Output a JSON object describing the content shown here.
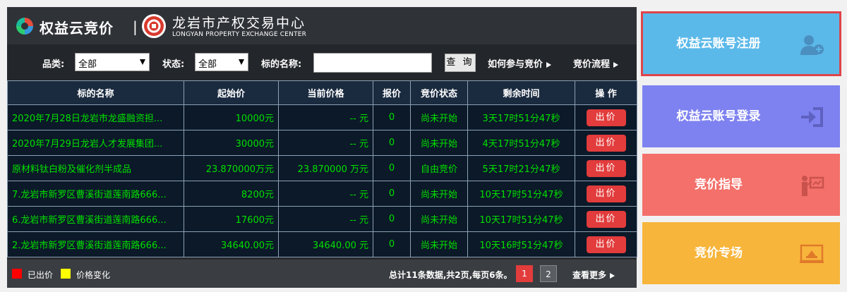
{
  "header": {
    "brand_name": "权益云竞价",
    "separator": "|",
    "org_name": "龙岩市产权交易中心",
    "org_name_en": "LONGYAN PROPERTY EXCHANGE CENTER"
  },
  "filters": {
    "category_label": "品类:",
    "category_value": "全部",
    "status_label": "状态:",
    "status_value": "全部",
    "name_label": "标的名称:",
    "name_value": "",
    "query_button": "查 询",
    "how_to_link": "如何参与竞价",
    "process_link": "竞价流程"
  },
  "table": {
    "columns": [
      "标的名称",
      "起始价",
      "当前价格",
      "报价",
      "竞价状态",
      "剩余时间",
      "操 作"
    ],
    "rows": [
      {
        "name": "2020年7月28日龙岩市龙盛融资担...",
        "start_price": "10000元",
        "current_price": "-- 元",
        "bids": "0",
        "status": "尚未开始",
        "remaining": "3天17时51分47秒",
        "action": "出价"
      },
      {
        "name": "2020年7月29日龙岩人才发展集团...",
        "start_price": "30000元",
        "current_price": "-- 元",
        "bids": "0",
        "status": "尚未开始",
        "remaining": "4天17时51分47秒",
        "action": "出价"
      },
      {
        "name": "原材料钛白粉及催化剂半成品",
        "start_price": "23.870000万元",
        "current_price": "23.870000 万元",
        "bids": "0",
        "status": "自由竞价",
        "remaining": "5天17时21分47秒",
        "action": "出价"
      },
      {
        "name": "7.龙岩市新罗区曹溪街道莲南路666...",
        "start_price": "8200元",
        "current_price": "-- 元",
        "bids": "0",
        "status": "尚未开始",
        "remaining": "10天17时51分47秒",
        "action": "出价"
      },
      {
        "name": "6.龙岩市新罗区曹溪街道莲南路666...",
        "start_price": "17600元",
        "current_price": "-- 元",
        "bids": "0",
        "status": "尚未开始",
        "remaining": "10天17时51分47秒",
        "action": "出价"
      },
      {
        "name": "2.龙岩市新罗区曹溪街道莲南路666...",
        "start_price": "34640.00元",
        "current_price": "34640.00 元",
        "bids": "0",
        "status": "尚未开始",
        "remaining": "10天16时51分47秒",
        "action": "出价"
      }
    ]
  },
  "footer": {
    "legend_bid": "已出价",
    "legend_change": "价格变化",
    "total_text": "总计11条数据,共2页,每页6条。",
    "pages": [
      "1",
      "2"
    ],
    "more_link": "查看更多"
  },
  "tiles": [
    {
      "label": "权益云账号注册",
      "color": "#5bb9ea",
      "icon": "add-user-icon"
    },
    {
      "label": "权益云账号登录",
      "color": "#7e82f0",
      "icon": "login-icon"
    },
    {
      "label": "竞价指导",
      "color": "#f4706a",
      "icon": "presenter-icon"
    },
    {
      "label": "竞价专场",
      "color": "#f8b53b",
      "icon": "auction-hammer-icon"
    }
  ],
  "colors": {
    "legend_bid": "#ff0000",
    "legend_change": "#ffff00",
    "active_page": "#e23c3c",
    "text_green": "#00e000"
  }
}
